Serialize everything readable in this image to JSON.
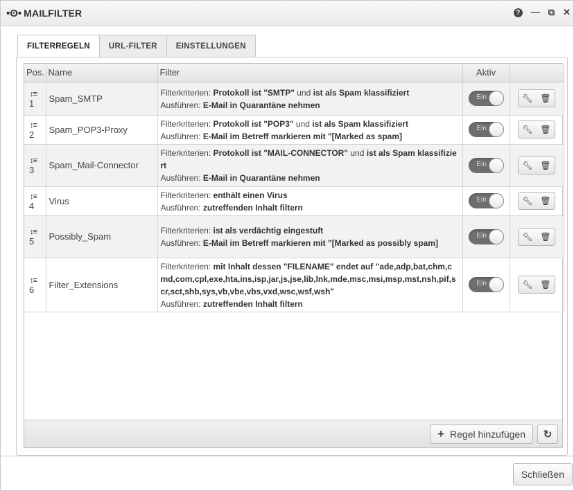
{
  "window": {
    "title_logo": "•ʘ•",
    "title": "MAILFILTER",
    "icons": [
      "help-icon",
      "minimize-icon",
      "popout-icon",
      "close-icon"
    ]
  },
  "tabs": [
    {
      "label": "FILTERREGELN",
      "active": true
    },
    {
      "label": "URL-FILTER",
      "active": false
    },
    {
      "label": "EINSTELLUNGEN",
      "active": false
    }
  ],
  "grid": {
    "columns": {
      "pos": "Pos.",
      "name": "Name",
      "filter": "Filter",
      "aktiv": "Aktiv",
      "actions": ""
    },
    "rows": [
      {
        "pos": "1",
        "name": "Spam_SMTP",
        "toggle": "Ein",
        "filter_parts": [
          [
            "Filterkriterien: ",
            false
          ],
          [
            "Protokoll ist \"SMTP\"",
            true
          ],
          [
            " und ",
            false
          ],
          [
            "ist als Spam klassifiziert",
            true
          ],
          [
            "\n",
            false
          ],
          [
            "Ausführen: ",
            false
          ],
          [
            "E-Mail in Quarantäne nehmen",
            true
          ]
        ]
      },
      {
        "pos": "2",
        "name": "Spam_POP3-Proxy",
        "toggle": "Ein",
        "filter_parts": [
          [
            "Filterkriterien: ",
            false
          ],
          [
            "Protokoll ist \"POP3\"",
            true
          ],
          [
            " und ",
            false
          ],
          [
            "ist als Spam klassifiziert",
            true
          ],
          [
            "\n",
            false
          ],
          [
            "Ausführen: ",
            false
          ],
          [
            "E-Mail im Betreff markieren mit \"[Marked as spam]",
            true
          ]
        ]
      },
      {
        "pos": "3",
        "name": "Spam_Mail-Connector",
        "toggle": "Ein",
        "filter_parts": [
          [
            "Filterkriterien: ",
            false
          ],
          [
            "Protokoll ist \"MAIL-CONNECTOR\"",
            true
          ],
          [
            " und ",
            false
          ],
          [
            "ist als Spam klassifiziert",
            true
          ],
          [
            "\n",
            false
          ],
          [
            "Ausführen: ",
            false
          ],
          [
            "E-Mail in Quarantäne nehmen",
            true
          ]
        ]
      },
      {
        "pos": "4",
        "name": "Virus",
        "toggle": "Ein",
        "filter_parts": [
          [
            "Filterkriterien: ",
            false
          ],
          [
            "enthält einen Virus",
            true
          ],
          [
            "\n",
            false
          ],
          [
            "Ausführen: ",
            false
          ],
          [
            "zutreffenden Inhalt filtern",
            true
          ]
        ]
      },
      {
        "pos": "5",
        "name": "Possibly_Spam",
        "toggle": "Ein",
        "filter_parts": [
          [
            "Filterkriterien: ",
            false
          ],
          [
            "ist als verdächtig eingestuft",
            true
          ],
          [
            "\n",
            false
          ],
          [
            "Ausführen: ",
            false
          ],
          [
            "E-Mail im Betreff markieren mit \"[Marked as possibly spam]",
            true
          ]
        ]
      },
      {
        "pos": "6",
        "name": "Filter_Extensions",
        "toggle": "Ein",
        "filter_parts": [
          [
            "Filterkriterien: ",
            false
          ],
          [
            "mit Inhalt dessen \"FILENAME\" endet auf \"ade,adp,bat,chm,cmd,com,cpl,exe,hta,ins,isp,jar,js,jse,lib,lnk,mde,msc,msi,msp,mst,nsh,pif,scr,sct,shb,sys,vb,vbe,vbs,vxd,wsc,wsf,wsh\"",
            true
          ],
          [
            "\n",
            false
          ],
          [
            "Ausführen: ",
            false
          ],
          [
            "zutreffenden Inhalt filtern",
            true
          ]
        ]
      }
    ]
  },
  "footer": {
    "add_rule_label": "Regel hinzufügen"
  },
  "dialog": {
    "close_label": "Schließen"
  }
}
